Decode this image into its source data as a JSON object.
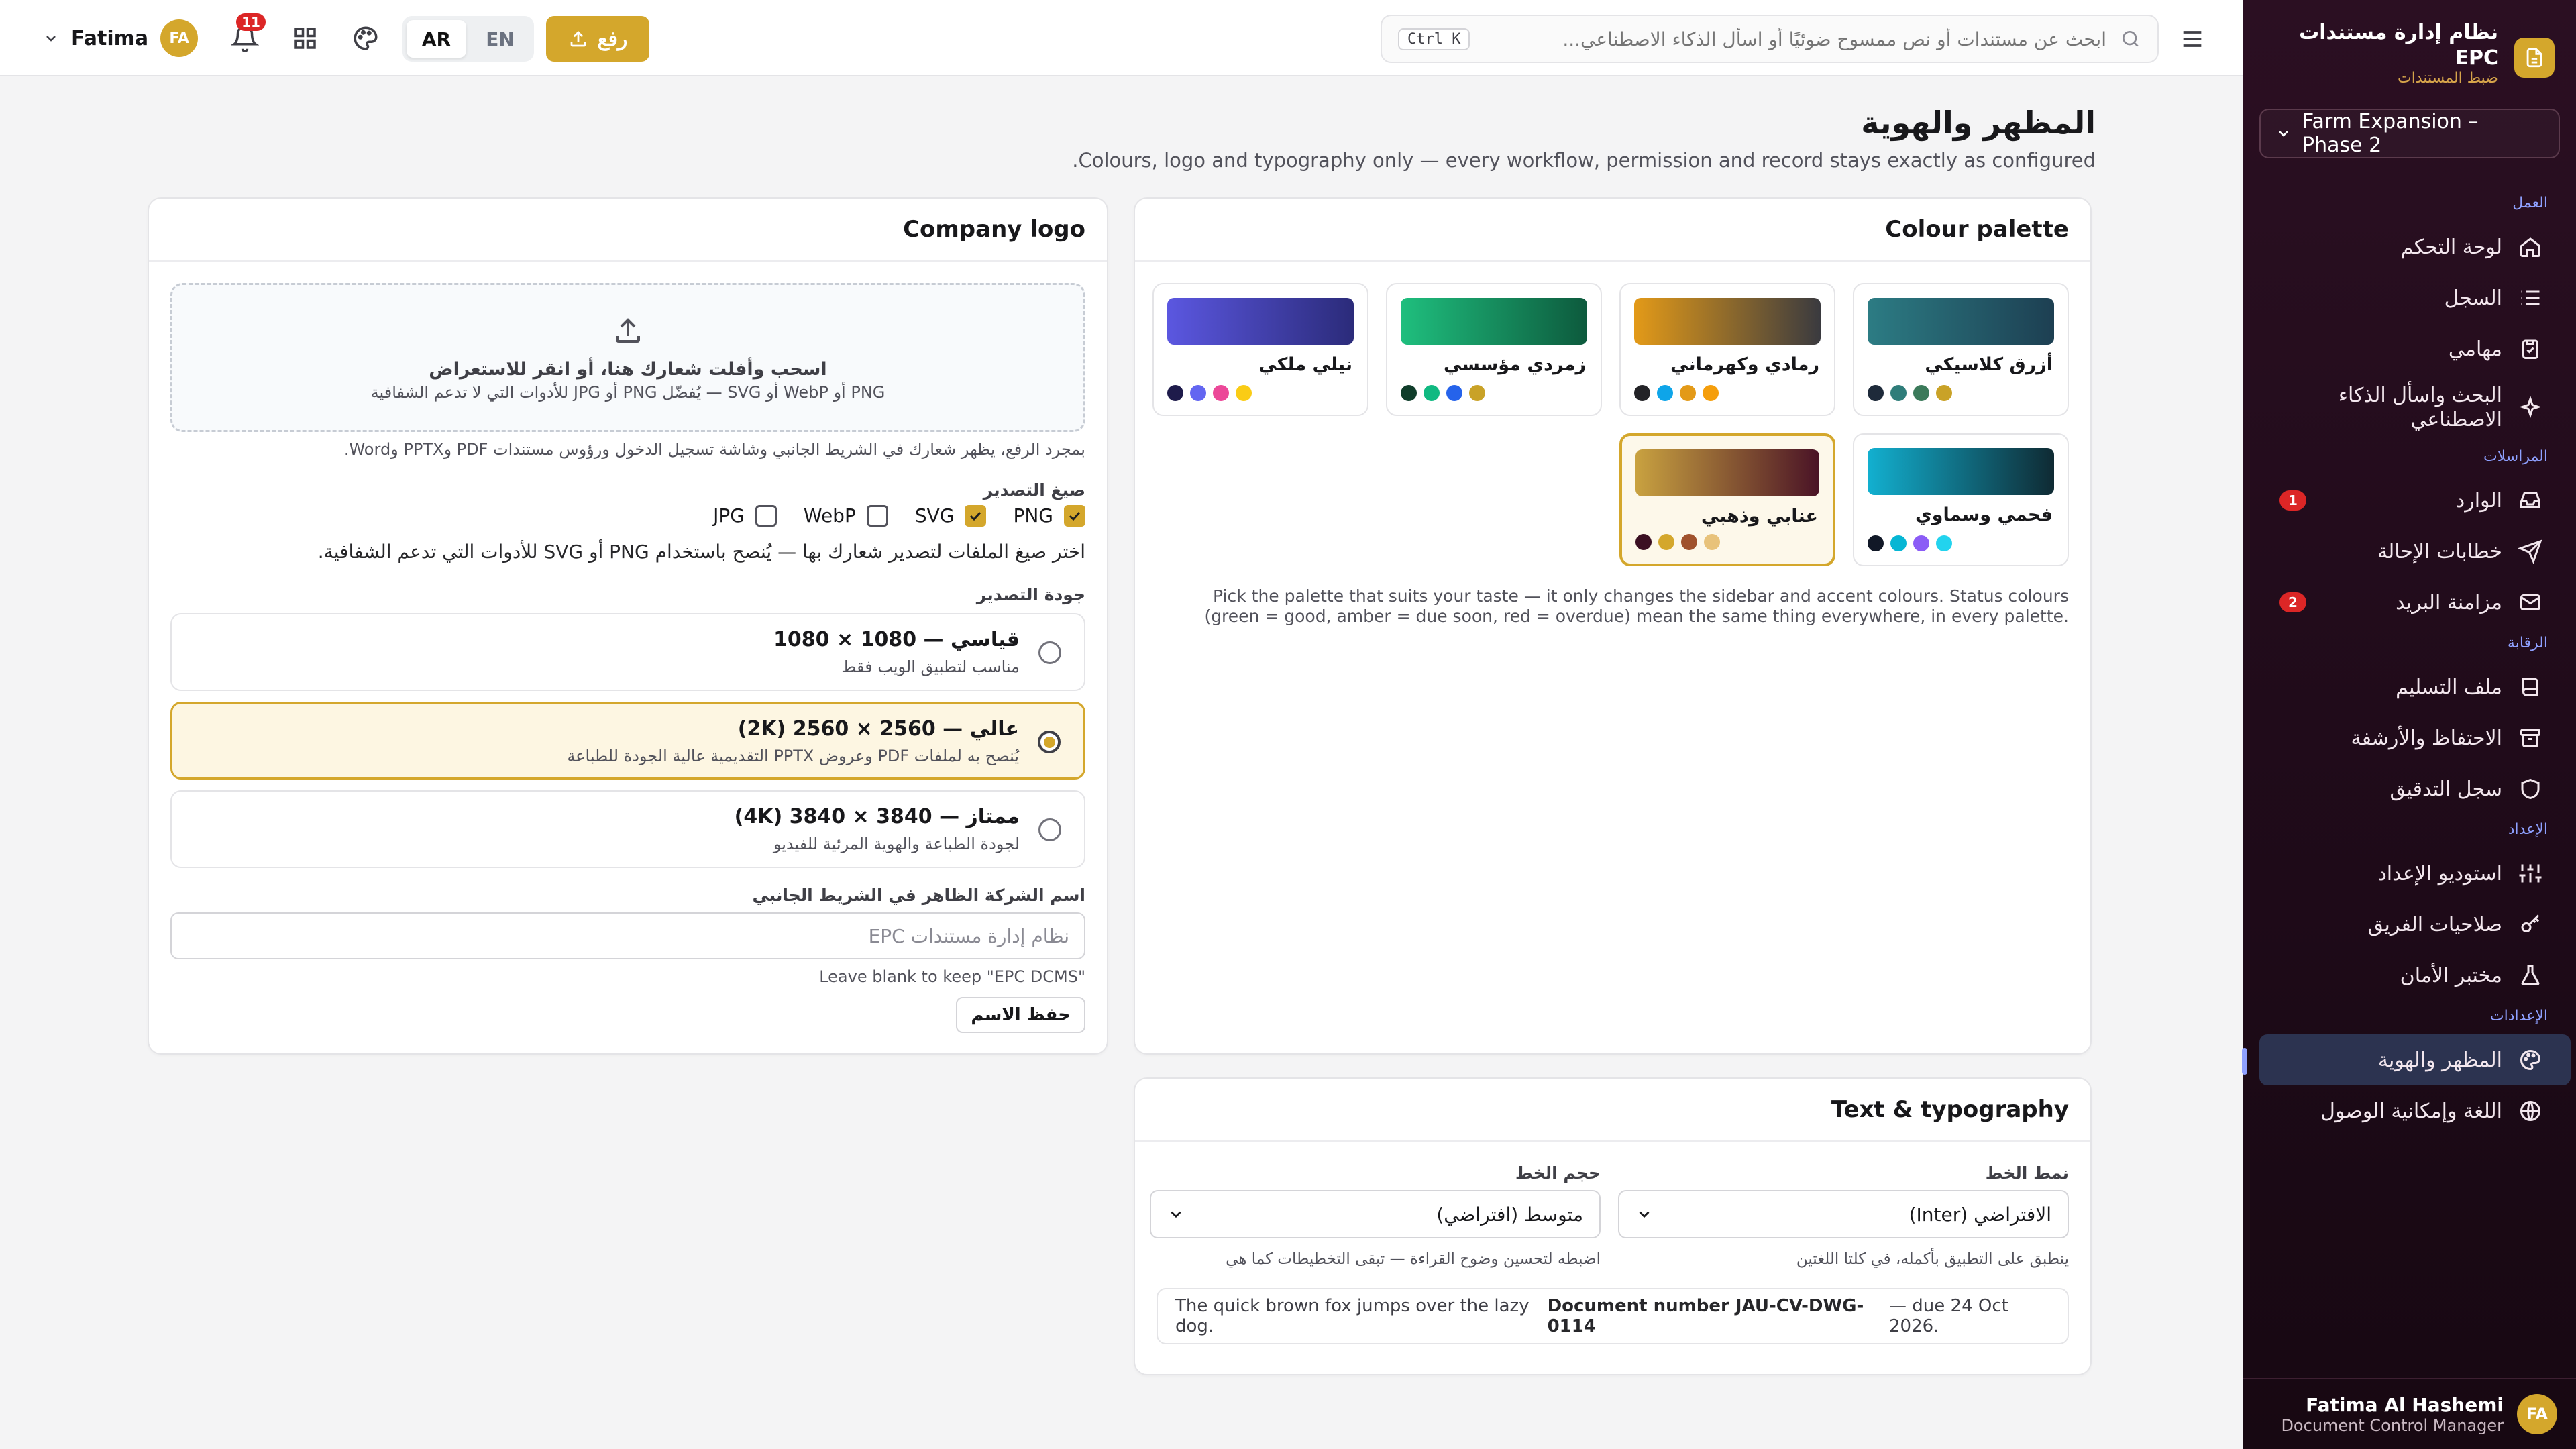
{
  "brand": {
    "title": "نظام إدارة مستندات EPC",
    "subtitle": "ضبط المستندات",
    "project": "Farm Expansion – Phase 2"
  },
  "nav": {
    "groups": [
      {
        "label": "العمل",
        "items": [
          {
            "label": "لوحة التحكم",
            "icon": "home-icon"
          },
          {
            "label": "السجل",
            "icon": "list-icon"
          },
          {
            "label": "مهامي",
            "icon": "clipboard-icon"
          },
          {
            "label": "البحث واسأل الذكاء الاصطناعي",
            "icon": "sparkle-icon"
          }
        ]
      },
      {
        "label": "المراسلات",
        "items": [
          {
            "label": "الوارد",
            "icon": "inbox-icon",
            "badge": "1"
          },
          {
            "label": "خطابات الإحالة",
            "icon": "send-icon"
          },
          {
            "label": "مزامنة البريد",
            "icon": "mail-icon",
            "badge": "2"
          }
        ]
      },
      {
        "label": "الرقابة",
        "items": [
          {
            "label": "ملف التسليم",
            "icon": "book-icon"
          },
          {
            "label": "الاحتفاظ والأرشفة",
            "icon": "archive-icon"
          },
          {
            "label": "سجل التدقيق",
            "icon": "shield-icon"
          }
        ]
      },
      {
        "label": "الإعداد",
        "items": [
          {
            "label": "استوديو الإعداد",
            "icon": "sliders-icon"
          },
          {
            "label": "صلاحيات الفريق",
            "icon": "key-icon"
          },
          {
            "label": "مختبر الأمان",
            "icon": "flask-icon"
          }
        ]
      },
      {
        "label": "الإعدادات",
        "items": [
          {
            "label": "المظهر والهوية",
            "icon": "palette-icon",
            "active": true
          },
          {
            "label": "اللغة وإمكانية الوصول",
            "icon": "globe-icon"
          }
        ]
      }
    ]
  },
  "user": {
    "name": "Fatima Al Hashemi",
    "role": "Document Control Manager",
    "initials": "FA",
    "short_name": "Fatima"
  },
  "topbar": {
    "search_placeholder": "ابحث عن مستندات أو نص ممسوح ضوئيًا أو اسأل الذكاء الاصطناعي...",
    "shortcut": "Ctrl K",
    "upload_label": "رفع",
    "lang_ar": "AR",
    "lang_en": "EN",
    "notifications": "11"
  },
  "page": {
    "title": "المظهر والهوية",
    "subtitle": "Colours, logo and typography only — every workflow, permission and record stays exactly as configured."
  },
  "palette": {
    "title": "Colour palette",
    "swatches": [
      {
        "name": "أزرق كلاسيكي",
        "gradient": [
          "#1d3f52",
          "#2c7c84"
        ],
        "dots": [
          "#1e2a3a",
          "#2f7d7a",
          "#3b7a5a",
          "#c9a227"
        ]
      },
      {
        "name": "رمادي وكهرماني",
        "gradient": [
          "#3a3a3f",
          "#e39a18"
        ],
        "dots": [
          "#232327",
          "#0ea5e9",
          "#e39a18",
          "#f59e0b"
        ]
      },
      {
        "name": "زمردي مؤسسي",
        "gradient": [
          "#0d5a3d",
          "#1fbf7e"
        ],
        "dots": [
          "#0f3d2a",
          "#10b981",
          "#2563eb",
          "#c9a227"
        ]
      },
      {
        "name": "نيلي ملكي",
        "gradient": [
          "#2b2b7a",
          "#5b57e0"
        ],
        "dots": [
          "#1e1b4b",
          "#6366f1",
          "#ec4899",
          "#facc15"
        ]
      },
      {
        "name": "فحمي وسماوي",
        "gradient": [
          "#0f2a33",
          "#12b0d0"
        ],
        "dots": [
          "#111827",
          "#06b6d4",
          "#8b5cf6",
          "#22d3ee"
        ]
      },
      {
        "name": "عنابي وذهبي",
        "gradient": [
          "#4a1326",
          "#c9a240"
        ],
        "dots": [
          "#3b0f22",
          "#d4a72c",
          "#a0522d",
          "#e8c27a"
        ],
        "selected": true
      }
    ],
    "note": "Pick the palette that suits your taste — it only changes the sidebar and accent colours. Status colours (green = good, amber = due soon, red = overdue) mean the same thing everywhere, in every palette."
  },
  "logo": {
    "title": "Company logo",
    "drop_title": "اسحب وأفلت شعارك هنا، أو انقر للاستعراض",
    "drop_sub": "PNG أو WebP أو SVG — يُفضّل PNG أو JPG للأدوات التي لا تدعم الشفافية",
    "after_upload": "بمجرد الرفع، يظهر شعارك في الشريط الجانبي وشاشة تسجيل الدخول ورؤوس مستندات PDF وPPTX وWord.",
    "formats_label": "صيغ التصدير",
    "formats": [
      {
        "label": "PNG",
        "checked": true
      },
      {
        "label": "SVG",
        "checked": true
      },
      {
        "label": "WebP",
        "checked": false
      },
      {
        "label": "JPG",
        "checked": false
      }
    ],
    "formats_note": "اختر صيغ الملفات لتصدير شعارك بها — يُنصح باستخدام PNG أو SVG للأدوات التي تدعم الشفافية.",
    "quality_label": "جودة التصدير",
    "qualities": [
      {
        "title": "قياسي — 1080 × 1080",
        "sub": "مناسب لتطبيق الويب فقط",
        "selected": false
      },
      {
        "title": "عالي — 2560 × 2560 (2K)",
        "sub": "يُنصح به لملفات PDF وعروض PPTX التقديمية عالية الجودة للطباعة",
        "selected": true
      },
      {
        "title": "ممتاز — 3840 × 3840 (4K)",
        "sub": "لجودة الطباعة والهوية المرئية للفيديو",
        "selected": false
      }
    ],
    "company_label": "اسم الشركة الظاهر في الشريط الجانبي",
    "company_placeholder": "نظام إدارة مستندات EPC",
    "company_hint": "Leave blank to keep \"EPC DCMS\"",
    "save_label": "حفظ الاسم"
  },
  "typography": {
    "title": "Text & typography",
    "font_label": "نمط الخط",
    "font_value": "الافتراضي (Inter)",
    "font_hint": "ينطبق على التطبيق بأكمله، في كلتا اللغتين",
    "size_label": "حجم الخط",
    "size_value": "متوسط (افتراضي)",
    "size_hint": "اضبطه لتحسين وضوح القراءة — تبقى التخطيطات كما هي",
    "preview_prefix": "The quick brown fox jumps over the lazy dog.",
    "preview_bold": "Document number JAU-CV-DWG-0114",
    "preview_suffix": "— due 24 Oct 2026."
  },
  "colors": {
    "accent": "#d4a72c",
    "sidebar": "#200b1a",
    "badge": "#dc2626"
  }
}
